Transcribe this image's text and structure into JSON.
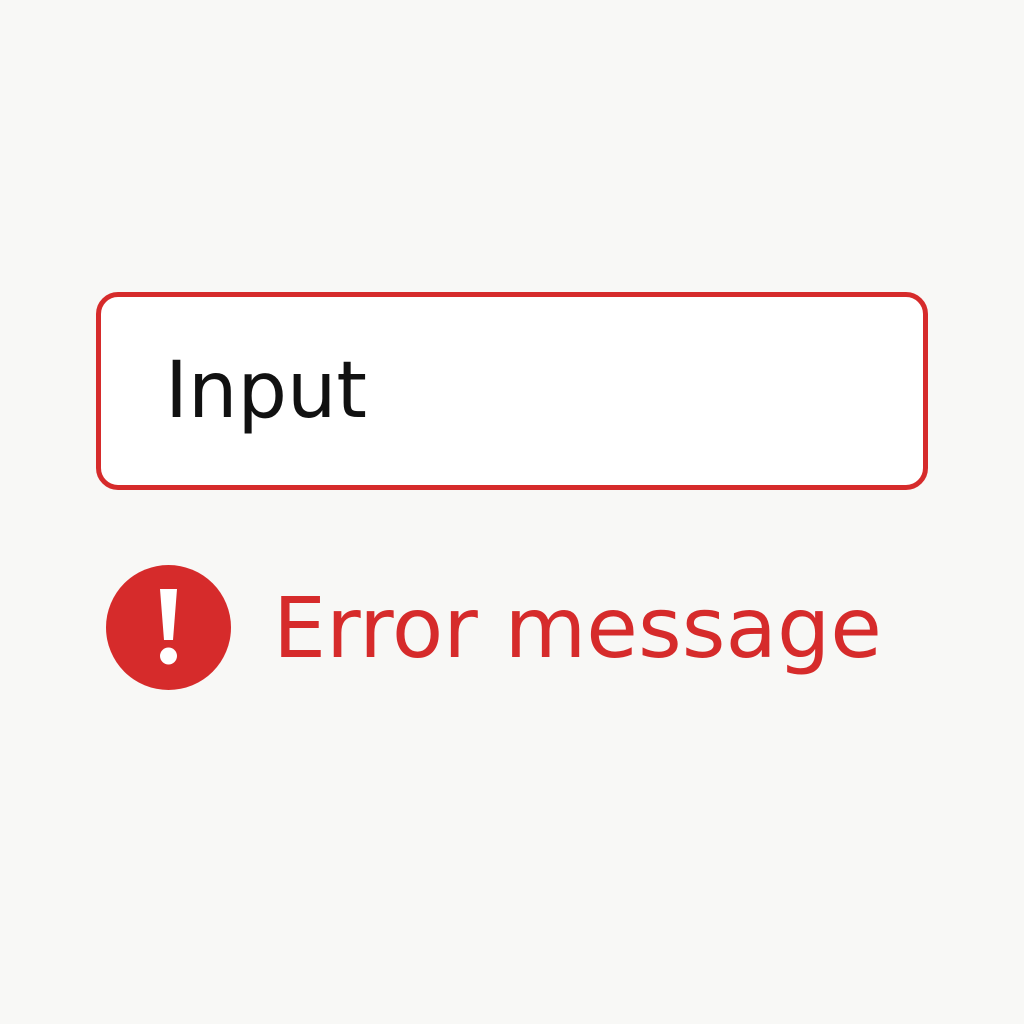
{
  "input": {
    "value": "Input"
  },
  "error": {
    "message": "Error message",
    "icon": "exclamation-circle-icon"
  },
  "colors": {
    "error": "#d62b2b",
    "text": "#111111",
    "field_background": "#ffffff",
    "page_background": "#f8f8f6"
  }
}
